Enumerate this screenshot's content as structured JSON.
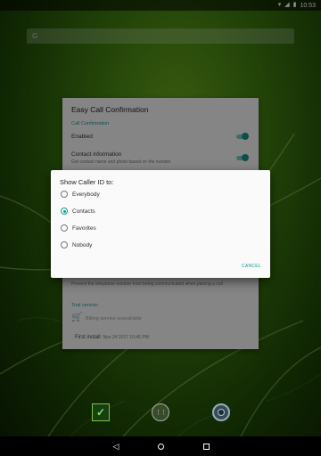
{
  "status_bar": {
    "time": "10:53",
    "icons": [
      "wifi-icon",
      "cell-signal-icon",
      "battery-icon"
    ]
  },
  "search_bar": {
    "icon": "google-g-icon",
    "placeholder": "G"
  },
  "card": {
    "title": "Easy Call Confirmation",
    "section_call_confirmation": "Call Confirmation",
    "enabled_label": "Enabled",
    "contact_info_label": "Contact information",
    "contact_info_sub": "Get contact name and photo based on the number",
    "prevent_text": "Prevent the telephone number from being communicated when placing a call",
    "section_trial": "Trial version",
    "cart_text": "Billing service unavailable",
    "first_install_label": "First install",
    "first_install_value": "Nov 24 2017 10:45 PM",
    "accent_color": "#159a92"
  },
  "dialog": {
    "title": "Show Caller ID to:",
    "options": [
      {
        "label": "Everybody",
        "selected": false
      },
      {
        "label": "Contacts",
        "selected": true
      },
      {
        "label": "Favorites",
        "selected": false
      },
      {
        "label": "Nobody",
        "selected": false
      }
    ],
    "cancel_label": "CANCEL"
  },
  "dock": {
    "apps": [
      "confirm-app-icon",
      "app-drawer-icon",
      "camera-icon"
    ]
  },
  "nav_bar": {
    "back": "◁",
    "home": "home-icon",
    "recents": "recents-icon"
  }
}
